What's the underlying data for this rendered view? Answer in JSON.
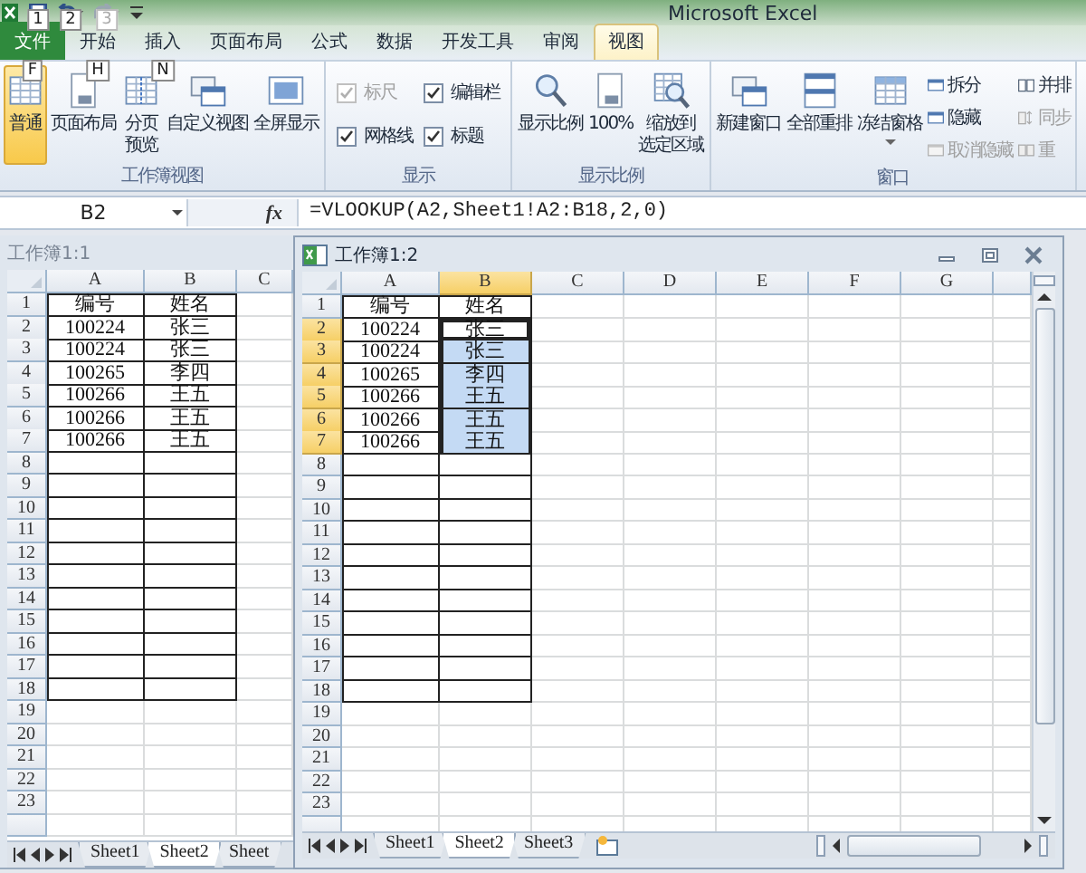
{
  "title": "Microsoft Excel",
  "quick_access": [
    {
      "keytip": "1",
      "disabled": false
    },
    {
      "keytip": "2",
      "disabled": false
    },
    {
      "keytip": "3",
      "disabled": true
    }
  ],
  "tabs": [
    {
      "label": "文件",
      "kind": "file",
      "selected": false,
      "keytip": "F"
    },
    {
      "label": "开始",
      "kind": "tab",
      "selected": false,
      "keytip": "H"
    },
    {
      "label": "插入",
      "kind": "tab",
      "selected": false,
      "keytip": "N"
    },
    {
      "label": "页面布局",
      "kind": "tab",
      "selected": false
    },
    {
      "label": "公式",
      "kind": "tab",
      "selected": false
    },
    {
      "label": "数据",
      "kind": "tab",
      "selected": false
    },
    {
      "label": "开发工具",
      "kind": "tab",
      "selected": false
    },
    {
      "label": "审阅",
      "kind": "tab",
      "selected": false
    },
    {
      "label": "视图",
      "kind": "tab",
      "selected": true
    }
  ],
  "ribbon_groups": [
    {
      "label": "工作簿视图",
      "controls": [
        {
          "kind": "large",
          "lines": [
            "普通"
          ],
          "selected": true
        },
        {
          "kind": "large",
          "lines": [
            "页面布局"
          ],
          "selected": false
        },
        {
          "kind": "large",
          "lines": [
            "分页",
            "预览"
          ],
          "selected": false
        },
        {
          "kind": "large",
          "lines": [
            "自定义视图"
          ],
          "selected": false
        },
        {
          "kind": "large",
          "lines": [
            "全屏显示"
          ],
          "selected": false
        }
      ]
    },
    {
      "label": "显示",
      "controls": [
        {
          "kind": "check",
          "label": "标尺",
          "checked": true,
          "disabled": true
        },
        {
          "kind": "check",
          "label": "编辑栏",
          "checked": true,
          "disabled": false
        },
        {
          "kind": "check",
          "label": "网格线",
          "checked": true,
          "disabled": false
        },
        {
          "kind": "check",
          "label": "标题",
          "checked": true,
          "disabled": false
        }
      ]
    },
    {
      "label": "显示比例",
      "controls": [
        {
          "kind": "large",
          "lines": [
            "显示比例"
          ],
          "selected": false
        },
        {
          "kind": "large",
          "lines": [
            "100%"
          ],
          "selected": false
        },
        {
          "kind": "large",
          "lines": [
            "缩放到",
            "选定区域"
          ],
          "selected": false
        }
      ]
    },
    {
      "label": "窗口",
      "controls": [
        {
          "kind": "large",
          "lines": [
            "新建窗口"
          ],
          "selected": false
        },
        {
          "kind": "large",
          "lines": [
            "全部重排"
          ],
          "selected": false
        },
        {
          "kind": "large",
          "lines": [
            "冻结窗格"
          ],
          "selected": false,
          "dropdown": true
        },
        {
          "kind": "small",
          "label": "拆分",
          "disabled": false
        },
        {
          "kind": "small",
          "label": "隐藏",
          "disabled": false
        },
        {
          "kind": "small",
          "label": "取消隐藏",
          "disabled": true
        },
        {
          "kind": "small",
          "label": "并排",
          "disabled": false
        },
        {
          "kind": "small",
          "label": "同步",
          "disabled": true
        },
        {
          "kind": "small",
          "label": "重",
          "disabled": true
        }
      ]
    }
  ],
  "formula_bar": {
    "name_box": "B2",
    "function_button": "fx",
    "formula": "=VLOOKUP(A2,Sheet1!A2:B18,2,0)"
  },
  "windows": [
    {
      "title": "工作簿1:1",
      "active": false,
      "columns": [
        {
          "label": "A",
          "selected": false
        },
        {
          "label": "B",
          "selected": false
        },
        {
          "label": "C",
          "selected": false
        }
      ],
      "rows": [
        {
          "header": "1",
          "selected": false,
          "bordered": true,
          "cells": [
            {
              "value": "编号",
              "selected": false,
              "active": false
            },
            {
              "value": "姓名",
              "selected": false,
              "active": false
            }
          ]
        },
        {
          "header": "2",
          "selected": false,
          "bordered": true,
          "cells": [
            {
              "value": "100224",
              "selected": false,
              "active": false
            },
            {
              "value": "张三",
              "selected": false,
              "active": false
            }
          ]
        },
        {
          "header": "3",
          "selected": false,
          "bordered": true,
          "cells": [
            {
              "value": "100224",
              "selected": false,
              "active": false
            },
            {
              "value": "张三",
              "selected": false,
              "active": false
            }
          ]
        },
        {
          "header": "4",
          "selected": false,
          "bordered": true,
          "cells": [
            {
              "value": "100265",
              "selected": false,
              "active": false
            },
            {
              "value": "李四",
              "selected": false,
              "active": false
            }
          ]
        },
        {
          "header": "5",
          "selected": false,
          "bordered": true,
          "cells": [
            {
              "value": "100266",
              "selected": false,
              "active": false
            },
            {
              "value": "王五",
              "selected": false,
              "active": false
            }
          ]
        },
        {
          "header": "6",
          "selected": false,
          "bordered": true,
          "cells": [
            {
              "value": "100266",
              "selected": false,
              "active": false
            },
            {
              "value": "王五",
              "selected": false,
              "active": false
            }
          ]
        },
        {
          "header": "7",
          "selected": false,
          "bordered": true,
          "cells": [
            {
              "value": "100266",
              "selected": false,
              "active": false
            },
            {
              "value": "王五",
              "selected": false,
              "active": false
            }
          ]
        },
        {
          "header": "8",
          "selected": false,
          "bordered": true
        },
        {
          "header": "9",
          "selected": false,
          "bordered": true
        },
        {
          "header": "10",
          "selected": false,
          "bordered": true
        },
        {
          "header": "11",
          "selected": false,
          "bordered": true
        },
        {
          "header": "12",
          "selected": false,
          "bordered": true
        },
        {
          "header": "13",
          "selected": false,
          "bordered": true
        },
        {
          "header": "14",
          "selected": false,
          "bordered": true
        },
        {
          "header": "15",
          "selected": false,
          "bordered": true
        },
        {
          "header": "16",
          "selected": false,
          "bordered": true
        },
        {
          "header": "17",
          "selected": false,
          "bordered": true
        },
        {
          "header": "18",
          "selected": false,
          "bordered": true
        },
        {
          "header": "19",
          "selected": false,
          "bordered": false
        },
        {
          "header": "20",
          "selected": false,
          "bordered": false
        },
        {
          "header": "21",
          "selected": false,
          "bordered": false
        },
        {
          "header": "22",
          "selected": false,
          "bordered": false
        },
        {
          "header": "23",
          "selected": false,
          "bordered": false
        }
      ],
      "sheets": [
        {
          "label": "Sheet1",
          "selected": false
        },
        {
          "label": "Sheet2",
          "selected": true
        },
        {
          "label": "Sheet",
          "selected": false
        }
      ]
    },
    {
      "title": "工作簿1:2",
      "active": true,
      "columns": [
        {
          "label": "A",
          "selected": false
        },
        {
          "label": "B",
          "selected": true
        },
        {
          "label": "C",
          "selected": false
        },
        {
          "label": "D",
          "selected": false
        },
        {
          "label": "E",
          "selected": false
        },
        {
          "label": "F",
          "selected": false
        },
        {
          "label": "G",
          "selected": false
        }
      ],
      "rows": [
        {
          "header": "1",
          "selected": false,
          "bordered": true,
          "cells": [
            {
              "value": "编号",
              "selected": false,
              "active": false
            },
            {
              "value": "姓名",
              "selected": false,
              "active": false
            }
          ]
        },
        {
          "header": "2",
          "selected": true,
          "bordered": true,
          "cells": [
            {
              "value": "100224",
              "selected": false,
              "active": false
            },
            {
              "value": "张三",
              "selected": false,
              "active": true
            }
          ]
        },
        {
          "header": "3",
          "selected": true,
          "bordered": true,
          "cells": [
            {
              "value": "100224",
              "selected": false,
              "active": false
            },
            {
              "value": "张三",
              "selected": true,
              "active": false
            }
          ]
        },
        {
          "header": "4",
          "selected": true,
          "bordered": true,
          "cells": [
            {
              "value": "100265",
              "selected": false,
              "active": false
            },
            {
              "value": "李四",
              "selected": true,
              "active": false
            }
          ]
        },
        {
          "header": "5",
          "selected": true,
          "bordered": true,
          "cells": [
            {
              "value": "100266",
              "selected": false,
              "active": false
            },
            {
              "value": "王五",
              "selected": true,
              "active": false
            }
          ]
        },
        {
          "header": "6",
          "selected": true,
          "bordered": true,
          "cells": [
            {
              "value": "100266",
              "selected": false,
              "active": false
            },
            {
              "value": "王五",
              "selected": true,
              "active": false
            }
          ]
        },
        {
          "header": "7",
          "selected": true,
          "bordered": true,
          "cells": [
            {
              "value": "100266",
              "selected": false,
              "active": false
            },
            {
              "value": "王五",
              "selected": true,
              "active": false
            }
          ]
        },
        {
          "header": "8",
          "selected": false,
          "bordered": true
        },
        {
          "header": "9",
          "selected": false,
          "bordered": true
        },
        {
          "header": "10",
          "selected": false,
          "bordered": true
        },
        {
          "header": "11",
          "selected": false,
          "bordered": true
        },
        {
          "header": "12",
          "selected": false,
          "bordered": true
        },
        {
          "header": "13",
          "selected": false,
          "bordered": true
        },
        {
          "header": "14",
          "selected": false,
          "bordered": true
        },
        {
          "header": "15",
          "selected": false,
          "bordered": true
        },
        {
          "header": "16",
          "selected": false,
          "bordered": true
        },
        {
          "header": "17",
          "selected": false,
          "bordered": true
        },
        {
          "header": "18",
          "selected": false,
          "bordered": true
        },
        {
          "header": "19",
          "selected": false,
          "bordered": false
        },
        {
          "header": "20",
          "selected": false,
          "bordered": false
        },
        {
          "header": "21",
          "selected": false,
          "bordered": false
        },
        {
          "header": "22",
          "selected": false,
          "bordered": false
        },
        {
          "header": "23",
          "selected": false,
          "bordered": false
        }
      ],
      "sheets": [
        {
          "label": "Sheet1",
          "selected": false
        },
        {
          "label": "Sheet2",
          "selected": true
        },
        {
          "label": "Sheet3",
          "selected": false
        }
      ]
    }
  ]
}
